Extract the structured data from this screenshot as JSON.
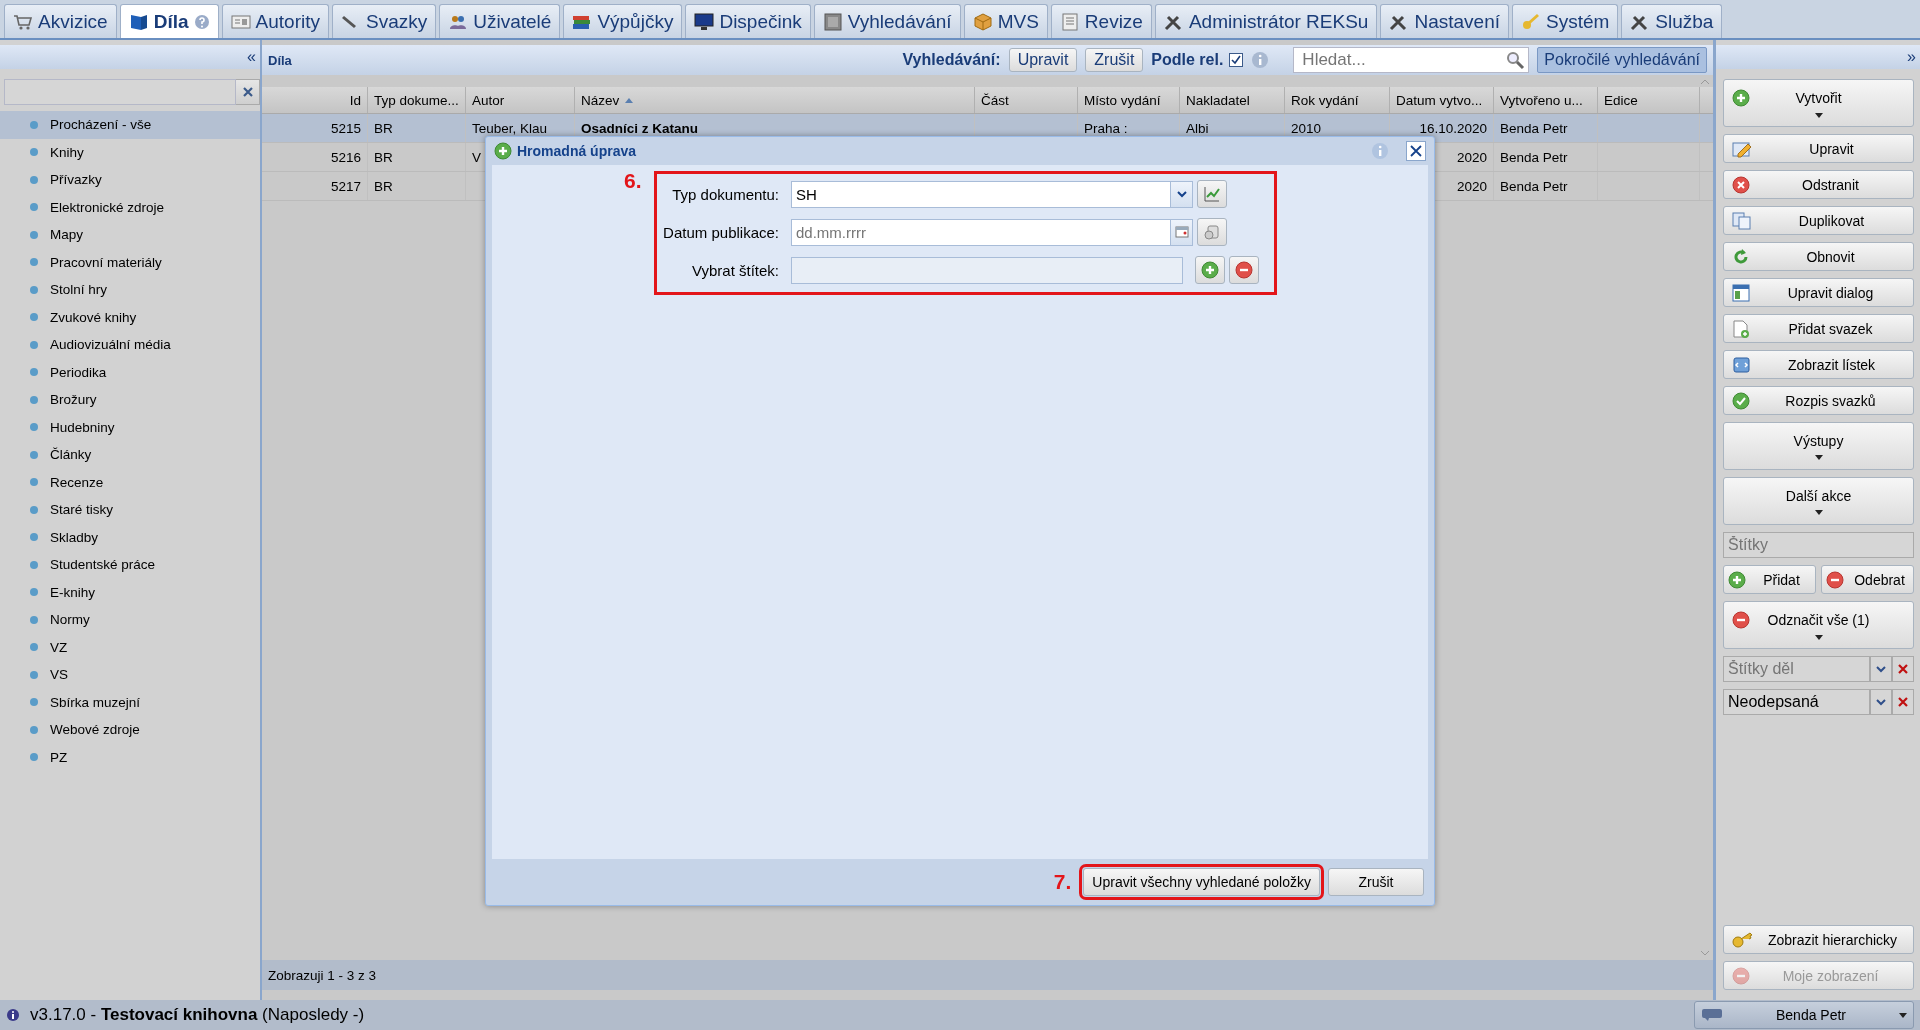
{
  "tabs": [
    {
      "label": "Akvizice",
      "selected": false
    },
    {
      "label": "Díla",
      "selected": true
    },
    {
      "label": "Autority",
      "selected": false
    },
    {
      "label": "Svazky",
      "selected": false
    },
    {
      "label": "Uživatelé",
      "selected": false
    },
    {
      "label": "Výpůjčky",
      "selected": false
    },
    {
      "label": "Dispečink",
      "selected": false
    },
    {
      "label": "Vyhledávání",
      "selected": false
    },
    {
      "label": "MVS",
      "selected": false
    },
    {
      "label": "Revize",
      "selected": false
    },
    {
      "label": "Administrátor REKSu",
      "selected": false
    },
    {
      "label": "Nastavení",
      "selected": false
    },
    {
      "label": "Systém",
      "selected": false
    },
    {
      "label": "Služba",
      "selected": false
    }
  ],
  "sidebar": {
    "collapse": "«",
    "items": [
      {
        "label": "Procházení - vše",
        "selected": true
      },
      {
        "label": "Knihy",
        "selected": false
      },
      {
        "label": "Přívazky",
        "selected": false
      },
      {
        "label": "Elektronické zdroje",
        "selected": false
      },
      {
        "label": "Mapy",
        "selected": false
      },
      {
        "label": "Pracovní materiály",
        "selected": false
      },
      {
        "label": "Stolní hry",
        "selected": false
      },
      {
        "label": "Zvukové knihy",
        "selected": false
      },
      {
        "label": "Audiovizuální média",
        "selected": false
      },
      {
        "label": "Periodika",
        "selected": false
      },
      {
        "label": "Brožury",
        "selected": false
      },
      {
        "label": "Hudebniny",
        "selected": false
      },
      {
        "label": "Články",
        "selected": false
      },
      {
        "label": "Recenze",
        "selected": false
      },
      {
        "label": "Staré tisky",
        "selected": false
      },
      {
        "label": "Skladby",
        "selected": false
      },
      {
        "label": "Studentské práce",
        "selected": false
      },
      {
        "label": "E-knihy",
        "selected": false
      },
      {
        "label": "Normy",
        "selected": false
      },
      {
        "label": "VZ",
        "selected": false
      },
      {
        "label": "VS",
        "selected": false
      },
      {
        "label": "Sbírka muzejní",
        "selected": false
      },
      {
        "label": "Webové zdroje",
        "selected": false
      },
      {
        "label": "PZ",
        "selected": false
      }
    ]
  },
  "toolbar": {
    "title": "Díla",
    "search_label": "Vyhledávání:",
    "buttons": [
      "Upravit",
      "Zrušit"
    ],
    "relevance": {
      "label": "Podle rel.",
      "checked": true
    },
    "search": {
      "placeholder": "Hledat..."
    },
    "advanced": "Pokročilé vyhledávání"
  },
  "table": {
    "columns": [
      "Id",
      "Typ dokume...",
      "Autor",
      "Název",
      "Část",
      "Místo vydání",
      "Nakladatel",
      "Rok vydání",
      "Datum vytvo...",
      "Vytvořeno u...",
      "Edice"
    ],
    "rows": [
      {
        "selected": true,
        "cells": [
          "5215",
          "BR",
          "Teuber, Klau",
          "Osadníci z Katanu",
          null,
          "Praha :",
          "Albi",
          "2010",
          "16.10.2020",
          "Benda Petr",
          null
        ]
      },
      {
        "selected": false,
        "cells": [
          "5216",
          "BR",
          "V",
          null,
          null,
          null,
          null,
          null,
          "2020",
          "Benda Petr",
          null
        ]
      },
      {
        "selected": false,
        "cells": [
          "5217",
          "BR",
          null,
          null,
          null,
          null,
          null,
          null,
          "2020",
          "Benda Petr",
          null
        ]
      }
    ],
    "footer": "Zobrazuji 1 - 3 z 3"
  },
  "dialog": {
    "title": "Hromadná úprava",
    "step": "6.",
    "fields": [
      {
        "kind": "combo",
        "label": "Typ dokumentu:",
        "value": "SH"
      },
      {
        "kind": "date",
        "label": "Datum publikace:",
        "placeholder": "dd.mm.rrrr"
      },
      {
        "kind": "tags",
        "label": "Vybrat štítek:"
      }
    ],
    "confirm": {
      "step": "7.",
      "label": "Upravit všechny vyhledané položky"
    },
    "cancel": "Zrušit"
  },
  "actions_panel": {
    "collapse": "»"
  },
  "actions": [
    {
      "kind": "split",
      "label": "Vytvořit"
    },
    {
      "kind": "button",
      "label": "Upravit"
    },
    {
      "kind": "button",
      "label": "Odstranit"
    },
    {
      "kind": "button",
      "label": "Duplikovat"
    },
    {
      "kind": "button",
      "label": "Obnovit"
    },
    {
      "kind": "button",
      "label": "Upravit dialog"
    },
    {
      "kind": "button",
      "label": "Přidat svazek"
    },
    {
      "kind": "button",
      "label": "Zobrazit lístek"
    },
    {
      "kind": "button",
      "label": "Rozpis svazků"
    },
    {
      "kind": "split",
      "label": "Výstupy"
    },
    {
      "kind": "split",
      "label": "Další akce"
    },
    {
      "kind": "field",
      "placeholder": "Štítky"
    },
    {
      "kind": "pair",
      "items": [
        {
          "label": "Přidat"
        },
        {
          "label": "Odebrat"
        }
      ]
    },
    {
      "kind": "split",
      "label": "Odznačit vše (1)"
    },
    {
      "kind": "combo",
      "placeholder": "Štítky děl"
    },
    {
      "kind": "combo",
      "value": "Neodepsaná"
    }
  ],
  "bottom_actions": [
    {
      "label": "Zobrazit hierarchicky",
      "disabled": false
    },
    {
      "label": "Moje zobrazení",
      "disabled": true
    }
  ],
  "status": {
    "text": "v3.17.0 - **Testovací knihovna** (Naposledy -)",
    "user": "Benda Petr"
  }
}
